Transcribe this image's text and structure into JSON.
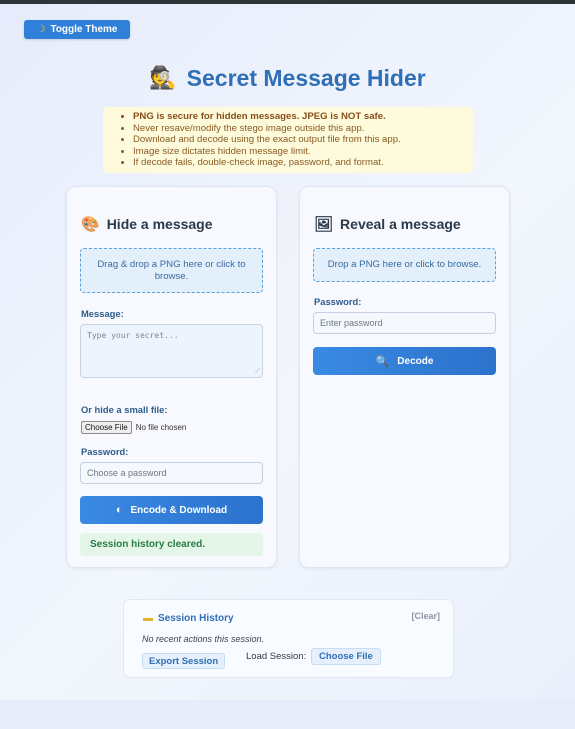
{
  "header": {
    "toggle_icon": "moon-icon",
    "toggle_label": "Toggle Theme",
    "title_icon": "spy-icon",
    "title": "Secret Message Hider"
  },
  "notice": {
    "items": [
      "PNG is secure for hidden messages. JPEG is NOT safe.",
      "Never resave/modify the stego image outside this app.",
      "Download and decode using the exact output file from this app.",
      "Image size dictates hidden message limit.",
      "If decode fails, double-check image, password, and format."
    ]
  },
  "hide": {
    "icon": "palette-icon",
    "title": "Hide a message",
    "dropzone": "Drag & drop a PNG here or click to browse.",
    "message_label": "Message:",
    "message_placeholder": "Type your secret...",
    "file_label": "Or hide a small file:",
    "choose_file": "Choose File",
    "no_file": "No file chosen",
    "password_label": "Password:",
    "password_placeholder": "Choose a password",
    "button_icon": "half-moon-icon",
    "button_label": "Encode & Download",
    "status": "Session history cleared."
  },
  "reveal": {
    "icon": "picture-icon",
    "title": "Reveal a message",
    "dropzone": "Drop a PNG here or click to browse.",
    "password_label": "Password:",
    "password_placeholder": "Enter password",
    "button_icon": "magnifier-icon",
    "button_label": "Decode"
  },
  "history": {
    "icon": "folder-icon",
    "title": "Session History",
    "clear": "[Clear]",
    "empty": "No recent actions this session.",
    "export": "Export Session",
    "load_label": "Load Session:",
    "choose_file": "Choose File"
  },
  "colors": {
    "accent": "#2f80d8",
    "title": "#2f6fb5",
    "notice_bg": "#fdfbdc",
    "success_bg": "#e4f6e7"
  }
}
